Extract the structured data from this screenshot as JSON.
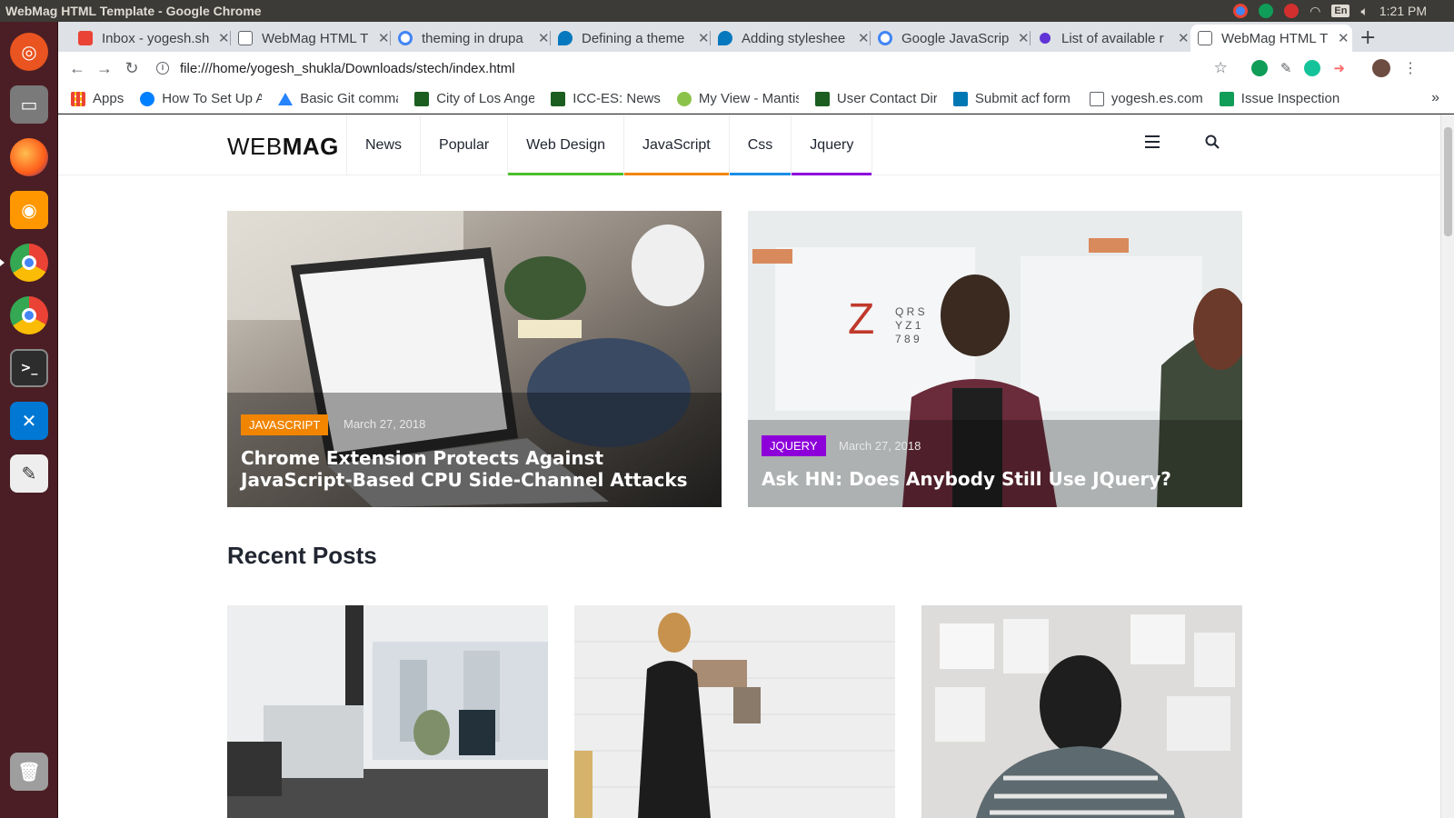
{
  "window": {
    "title": "WebMag HTML Template - Google Chrome"
  },
  "system_tray": {
    "input_method": "En",
    "time": "1:21 PM"
  },
  "launcher": {
    "apps": [
      {
        "name": "Ubuntu",
        "color": "#e95420"
      },
      {
        "name": "Files",
        "color": "#6b6b6b"
      },
      {
        "name": "Firefox",
        "color": "#ff7139"
      },
      {
        "name": "Sublime",
        "color": "#ff9800"
      },
      {
        "name": "Chrome",
        "color": "#4285f4"
      },
      {
        "name": "Chrome",
        "color": "#4285f4"
      },
      {
        "name": "Terminal",
        "color": "#2d2d2d"
      },
      {
        "name": "VS Code",
        "color": "#0078d4"
      },
      {
        "name": "Text Editor",
        "color": "#eeeeee"
      },
      {
        "name": "Trash",
        "color": "#9e9e9e"
      }
    ]
  },
  "tabs": [
    {
      "label": "Inbox - yogesh.sh",
      "fav": "#ea4335"
    },
    {
      "label": "WebMag HTML T",
      "fav": "#e8eaed"
    },
    {
      "label": "theming in drupa",
      "fav": "#4285f4"
    },
    {
      "label": "Defining a theme",
      "fav": "#0678be"
    },
    {
      "label": "Adding styleshee",
      "fav": "#0678be"
    },
    {
      "label": "Google JavaScrip",
      "fav": "#4285f4"
    },
    {
      "label": "List of available r",
      "fav": "#5f33d6"
    },
    {
      "label": "WebMag HTML T",
      "fav": "#e8eaed"
    }
  ],
  "toolbar": {
    "url": "file:///home/yogesh_shukla/Downloads/stech/index.html"
  },
  "bookmarks": [
    {
      "label": "Apps",
      "fav": "#ea4335"
    },
    {
      "label": "How To Set Up A",
      "fav": "#0080ff"
    },
    {
      "label": "Basic Git comma",
      "fav": "#2684ff"
    },
    {
      "label": "City of Los Ange",
      "fav": "#1b5e20"
    },
    {
      "label": "ICC-ES: News",
      "fav": "#1b5e20"
    },
    {
      "label": "My View - Mantis",
      "fav": "#8bc34a"
    },
    {
      "label": "User Contact Dir",
      "fav": "#1b5e20"
    },
    {
      "label": "Submit acf form",
      "fav": "#0077b5"
    },
    {
      "label": "yogesh.es.com",
      "fav": "#e8eaed"
    },
    {
      "label": "Issue Inspection",
      "fav": "#0f9d58"
    }
  ],
  "site": {
    "logo_light": "WEB",
    "logo_bold": "MAG",
    "nav": [
      {
        "label": "News",
        "color": ""
      },
      {
        "label": "Popular",
        "color": ""
      },
      {
        "label": "Web Design",
        "color": "#4bbf2c"
      },
      {
        "label": "JavaScript",
        "color": "#f18500"
      },
      {
        "label": "Css",
        "color": "#1b8ee6"
      },
      {
        "label": "Jquery",
        "color": "#8d00d9"
      }
    ],
    "featured": [
      {
        "category": "JAVASCRIPT",
        "color": "#f18500",
        "date": "March 27, 2018",
        "title": "Chrome Extension Protects Against JavaScript-Based CPU Side-Channel Attacks"
      },
      {
        "category": "JQUERY",
        "color": "#8d00d9",
        "date": "March 27, 2018",
        "title": "Ask HN: Does Anybody Still Use JQuery?"
      }
    ],
    "recent_title": "Recent Posts"
  }
}
